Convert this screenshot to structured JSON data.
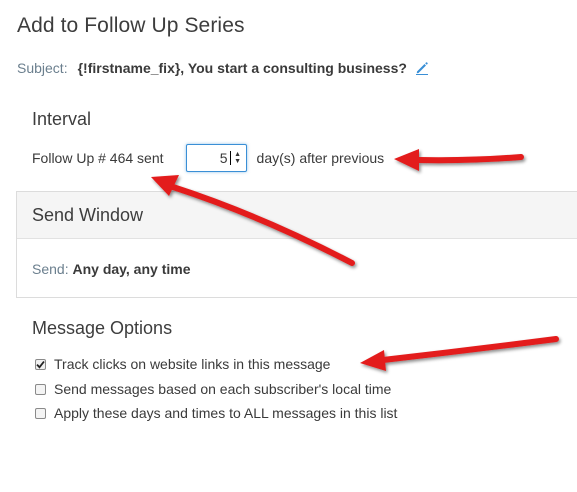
{
  "page": {
    "title": "Add to Follow Up Series"
  },
  "subject": {
    "label": "Subject:",
    "value": "{!firstname_fix}, You start a consulting business?",
    "edit_icon": "pencil-icon"
  },
  "interval": {
    "heading": "Interval",
    "prefix": "Follow Up # 464 sent",
    "days_value": "5",
    "suffix": "day(s) after previous"
  },
  "send_window": {
    "heading": "Send Window",
    "label": "Send:",
    "value": "Any day, any time"
  },
  "message_options": {
    "heading": "Message Options",
    "options": [
      {
        "label": "Track clicks on website links in this message",
        "checked": true
      },
      {
        "label": "Send messages based on each subscriber's local time",
        "checked": false
      },
      {
        "label": "Apply these days and times to ALL messages in this list",
        "checked": false
      }
    ]
  },
  "colors": {
    "accent": "#3a8fd6",
    "annotation_arrow": "#e31b1b"
  }
}
